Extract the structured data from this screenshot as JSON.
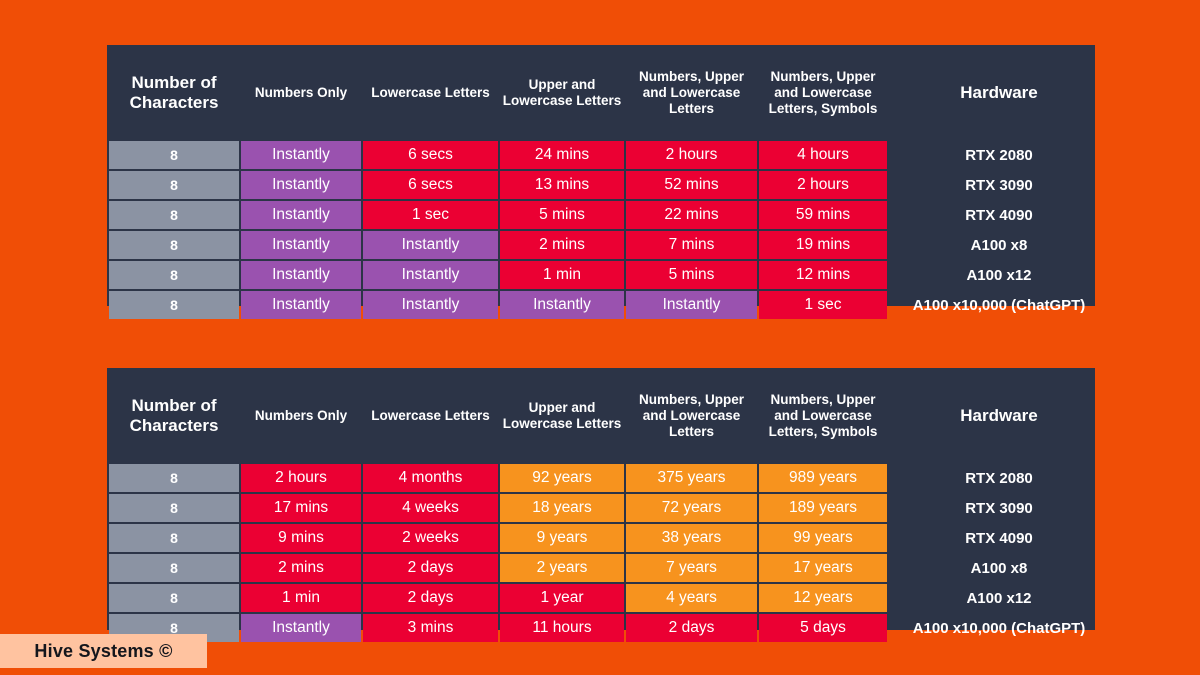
{
  "background_color": "#F04E06",
  "palette": {
    "card": "#2C3447",
    "chars_cell": "#8B93A3",
    "instantly_purple": "#9A52AF",
    "fast_red": "#EB0033",
    "slow_orange": "#F7931E",
    "text": "#FFFFFF",
    "brand_bar": "#FFC3A0"
  },
  "brand": {
    "label": "Hive Systems ©"
  },
  "columns": [
    {
      "key": "chars",
      "label": "Number of Characters"
    },
    {
      "key": "numbers_only",
      "label": "Numbers Only"
    },
    {
      "key": "lowercase",
      "label": "Lowercase Letters"
    },
    {
      "key": "upper_lower",
      "label": "Upper and Lowercase Letters"
    },
    {
      "key": "num_upper_lower",
      "label": "Numbers, Upper and Lowercase Letters"
    },
    {
      "key": "num_upper_lower_sym",
      "label": "Numbers, Upper and Lowercase Letters, Symbols"
    },
    {
      "key": "hardware",
      "label": "Hardware"
    }
  ],
  "tables": [
    {
      "id": "table-1",
      "headers": {
        "chars": "Number of Characters",
        "numbers_only": "Numbers Only",
        "lowercase": "Lowercase Letters",
        "upper_lower": "Upper and Lowercase Letters",
        "num_upper_lower": "Numbers, Upper and Lowercase Letters",
        "num_upper_lower_sym": "Numbers, Upper and Lowercase Letters, Symbols",
        "hardware": "Hardware"
      },
      "rows": [
        {
          "chars": "8",
          "numbers_only": {
            "text": "Instantly",
            "color": "purple"
          },
          "lowercase": {
            "text": "6 secs",
            "color": "red"
          },
          "upper_lower": {
            "text": "24 mins",
            "color": "red"
          },
          "num_upper_lower": {
            "text": "2 hours",
            "color": "red"
          },
          "num_upper_lower_sym": {
            "text": "4 hours",
            "color": "red"
          },
          "hardware": "RTX 2080"
        },
        {
          "chars": "8",
          "numbers_only": {
            "text": "Instantly",
            "color": "purple"
          },
          "lowercase": {
            "text": "6 secs",
            "color": "red"
          },
          "upper_lower": {
            "text": "13 mins",
            "color": "red"
          },
          "num_upper_lower": {
            "text": "52 mins",
            "color": "red"
          },
          "num_upper_lower_sym": {
            "text": "2 hours",
            "color": "red"
          },
          "hardware": "RTX 3090"
        },
        {
          "chars": "8",
          "numbers_only": {
            "text": "Instantly",
            "color": "purple"
          },
          "lowercase": {
            "text": "1 sec",
            "color": "red"
          },
          "upper_lower": {
            "text": "5 mins",
            "color": "red"
          },
          "num_upper_lower": {
            "text": "22 mins",
            "color": "red"
          },
          "num_upper_lower_sym": {
            "text": "59 mins",
            "color": "red"
          },
          "hardware": "RTX 4090"
        },
        {
          "chars": "8",
          "numbers_only": {
            "text": "Instantly",
            "color": "purple"
          },
          "lowercase": {
            "text": "Instantly",
            "color": "purple"
          },
          "upper_lower": {
            "text": "2 mins",
            "color": "red"
          },
          "num_upper_lower": {
            "text": "7 mins",
            "color": "red"
          },
          "num_upper_lower_sym": {
            "text": "19 mins",
            "color": "red"
          },
          "hardware": "A100 x8"
        },
        {
          "chars": "8",
          "numbers_only": {
            "text": "Instantly",
            "color": "purple"
          },
          "lowercase": {
            "text": "Instantly",
            "color": "purple"
          },
          "upper_lower": {
            "text": "1 min",
            "color": "red"
          },
          "num_upper_lower": {
            "text": "5 mins",
            "color": "red"
          },
          "num_upper_lower_sym": {
            "text": "12 mins",
            "color": "red"
          },
          "hardware": "A100 x12"
        },
        {
          "chars": "8",
          "numbers_only": {
            "text": "Instantly",
            "color": "purple"
          },
          "lowercase": {
            "text": "Instantly",
            "color": "purple"
          },
          "upper_lower": {
            "text": "Instantly",
            "color": "purple"
          },
          "num_upper_lower": {
            "text": "Instantly",
            "color": "purple"
          },
          "num_upper_lower_sym": {
            "text": "1 sec",
            "color": "red"
          },
          "hardware": "A100 x10,000 (ChatGPT)"
        }
      ]
    },
    {
      "id": "table-2",
      "headers": {
        "chars": "Number of Characters",
        "numbers_only": "Numbers Only",
        "lowercase": "Lowercase Letters",
        "upper_lower": "Upper and Lowercase Letters",
        "num_upper_lower": "Numbers, Upper and Lowercase Letters",
        "num_upper_lower_sym": "Numbers, Upper and Lowercase Letters, Symbols",
        "hardware": "Hardware"
      },
      "rows": [
        {
          "chars": "8",
          "numbers_only": {
            "text": "2 hours",
            "color": "red"
          },
          "lowercase": {
            "text": "4 months",
            "color": "red"
          },
          "upper_lower": {
            "text": "92 years",
            "color": "orange"
          },
          "num_upper_lower": {
            "text": "375 years",
            "color": "orange"
          },
          "num_upper_lower_sym": {
            "text": "989 years",
            "color": "orange"
          },
          "hardware": "RTX 2080"
        },
        {
          "chars": "8",
          "numbers_only": {
            "text": "17 mins",
            "color": "red"
          },
          "lowercase": {
            "text": "4 weeks",
            "color": "red"
          },
          "upper_lower": {
            "text": "18 years",
            "color": "orange"
          },
          "num_upper_lower": {
            "text": "72 years",
            "color": "orange"
          },
          "num_upper_lower_sym": {
            "text": "189 years",
            "color": "orange"
          },
          "hardware": "RTX 3090"
        },
        {
          "chars": "8",
          "numbers_only": {
            "text": "9 mins",
            "color": "red"
          },
          "lowercase": {
            "text": "2 weeks",
            "color": "red"
          },
          "upper_lower": {
            "text": "9 years",
            "color": "orange"
          },
          "num_upper_lower": {
            "text": "38 years",
            "color": "orange"
          },
          "num_upper_lower_sym": {
            "text": "99 years",
            "color": "orange"
          },
          "hardware": "RTX 4090"
        },
        {
          "chars": "8",
          "numbers_only": {
            "text": "2 mins",
            "color": "red"
          },
          "lowercase": {
            "text": "2 days",
            "color": "red"
          },
          "upper_lower": {
            "text": "2 years",
            "color": "orange"
          },
          "num_upper_lower": {
            "text": "7 years",
            "color": "orange"
          },
          "num_upper_lower_sym": {
            "text": "17 years",
            "color": "orange"
          },
          "hardware": "A100 x8"
        },
        {
          "chars": "8",
          "numbers_only": {
            "text": "1 min",
            "color": "red"
          },
          "lowercase": {
            "text": "2 days",
            "color": "red"
          },
          "upper_lower": {
            "text": "1 year",
            "color": "red"
          },
          "num_upper_lower": {
            "text": "4 years",
            "color": "orange"
          },
          "num_upper_lower_sym": {
            "text": "12 years",
            "color": "orange"
          },
          "hardware": "A100 x12"
        },
        {
          "chars": "8",
          "numbers_only": {
            "text": "Instantly",
            "color": "purple"
          },
          "lowercase": {
            "text": "3 mins",
            "color": "red"
          },
          "upper_lower": {
            "text": "11 hours",
            "color": "red"
          },
          "num_upper_lower": {
            "text": "2 days",
            "color": "red"
          },
          "num_upper_lower_sym": {
            "text": "5 days",
            "color": "red"
          },
          "hardware": "A100 x10,000 (ChatGPT)"
        }
      ]
    }
  ]
}
